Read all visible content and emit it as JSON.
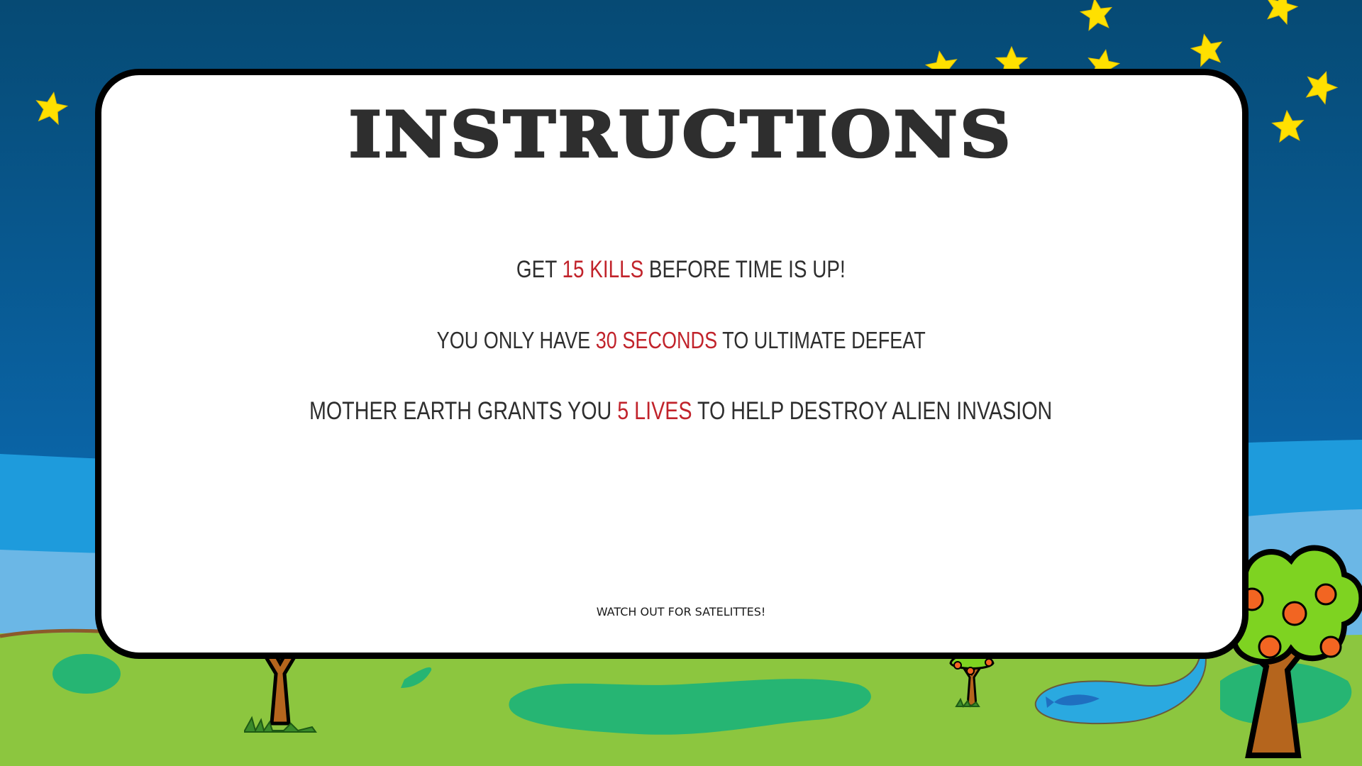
{
  "title": "INSTRUCTIONS",
  "lines": [
    {
      "before": "GET ",
      "highlight": "15 KILLS",
      "after": " BEFORE TIME IS UP!"
    },
    {
      "before": "YOU ONLY HAVE ",
      "highlight": "30 SECONDS",
      "after": " TO ULTIMATE DEFEAT"
    },
    {
      "before": "MOTHER EARTH GRANTS YOU ",
      "highlight": "5 LIVES",
      "after": " TO HELP DESTROY ALIEN INVASION"
    }
  ],
  "footer": "WATCH OUT FOR SATELITTES!",
  "colors": {
    "sky_top": "#07507e",
    "sky_mid": "#0a6bb0",
    "hill_far": "#1e9bdc",
    "hill_light": "#6bb7e6",
    "grass": "#8cc63f",
    "grass_patch": "#26b573",
    "star": "#ffe000",
    "text": "#2e2e2e",
    "highlight": "#c1232b",
    "panel": "#ffffff"
  },
  "icons": [
    "star-icon",
    "tree-icon",
    "pond-icon",
    "fish-icon",
    "grass-tuft-icon"
  ]
}
